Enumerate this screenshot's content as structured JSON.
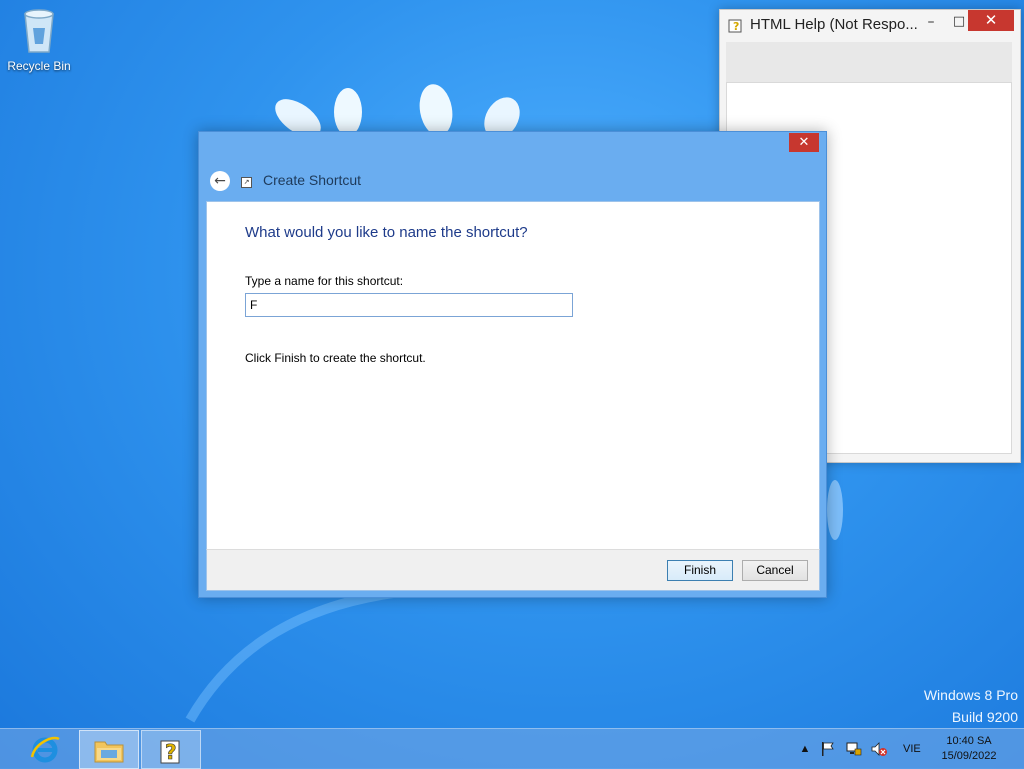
{
  "desktop": {
    "recycle_bin_label": "Recycle Bin",
    "watermark_line1": "Windows 8 Pro",
    "watermark_line2": "Build 9200"
  },
  "help_window": {
    "title": "HTML Help (Not Respo...",
    "minimize_symbol": "–",
    "maximize_symbol": "□",
    "close_symbol": "✕"
  },
  "dialog": {
    "title": "Create Shortcut",
    "close_symbol": "✕",
    "back_symbol": "←",
    "heading": "What would you like to name the shortcut?",
    "name_label": "Type a name for this shortcut:",
    "name_value": "F",
    "finish_hint": "Click Finish to create the shortcut.",
    "finish_button": "Finish",
    "cancel_button": "Cancel"
  },
  "taskbar": {
    "tray_up_symbol": "▲",
    "language": "VIE",
    "time": "10:40 SA",
    "date": "15/09/2022"
  }
}
